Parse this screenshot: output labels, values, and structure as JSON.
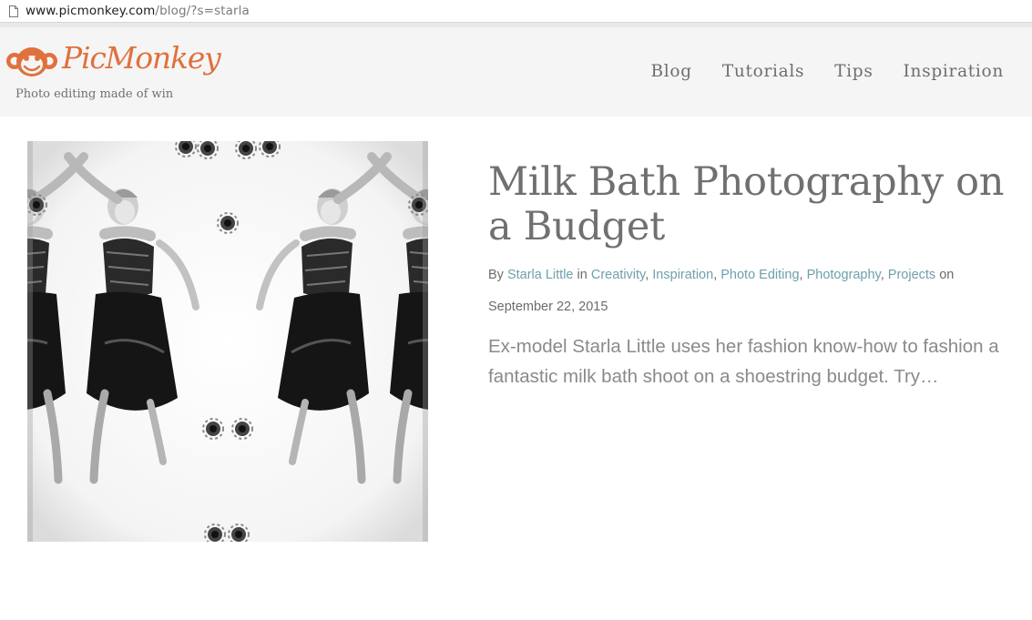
{
  "browser": {
    "url_domain": "www.picmonkey.com",
    "url_path": "/blog/?s=starla"
  },
  "header": {
    "logo_text": "PicMonkey",
    "tagline": "Photo editing made of win",
    "brand_color": "#e0713d",
    "nav": [
      {
        "label": "Blog"
      },
      {
        "label": "Tutorials"
      },
      {
        "label": "Tips"
      },
      {
        "label": "Inspiration"
      }
    ]
  },
  "post": {
    "title": "Milk Bath Photography on a Budget",
    "by_label": "By",
    "author": "Starla Little",
    "in_label": "in",
    "categories": [
      {
        "label": "Creativity"
      },
      {
        "label": "Inspiration"
      },
      {
        "label": "Photo Editing"
      },
      {
        "label": "Photography"
      },
      {
        "label": "Projects"
      }
    ],
    "on_label": "on",
    "date": "September 22, 2015",
    "excerpt": "Ex-model Starla Little uses her fashion know-how to fashion a fantastic milk bath shoot on a shoestring budget. Try…",
    "link_color": "#6ea0ad"
  }
}
